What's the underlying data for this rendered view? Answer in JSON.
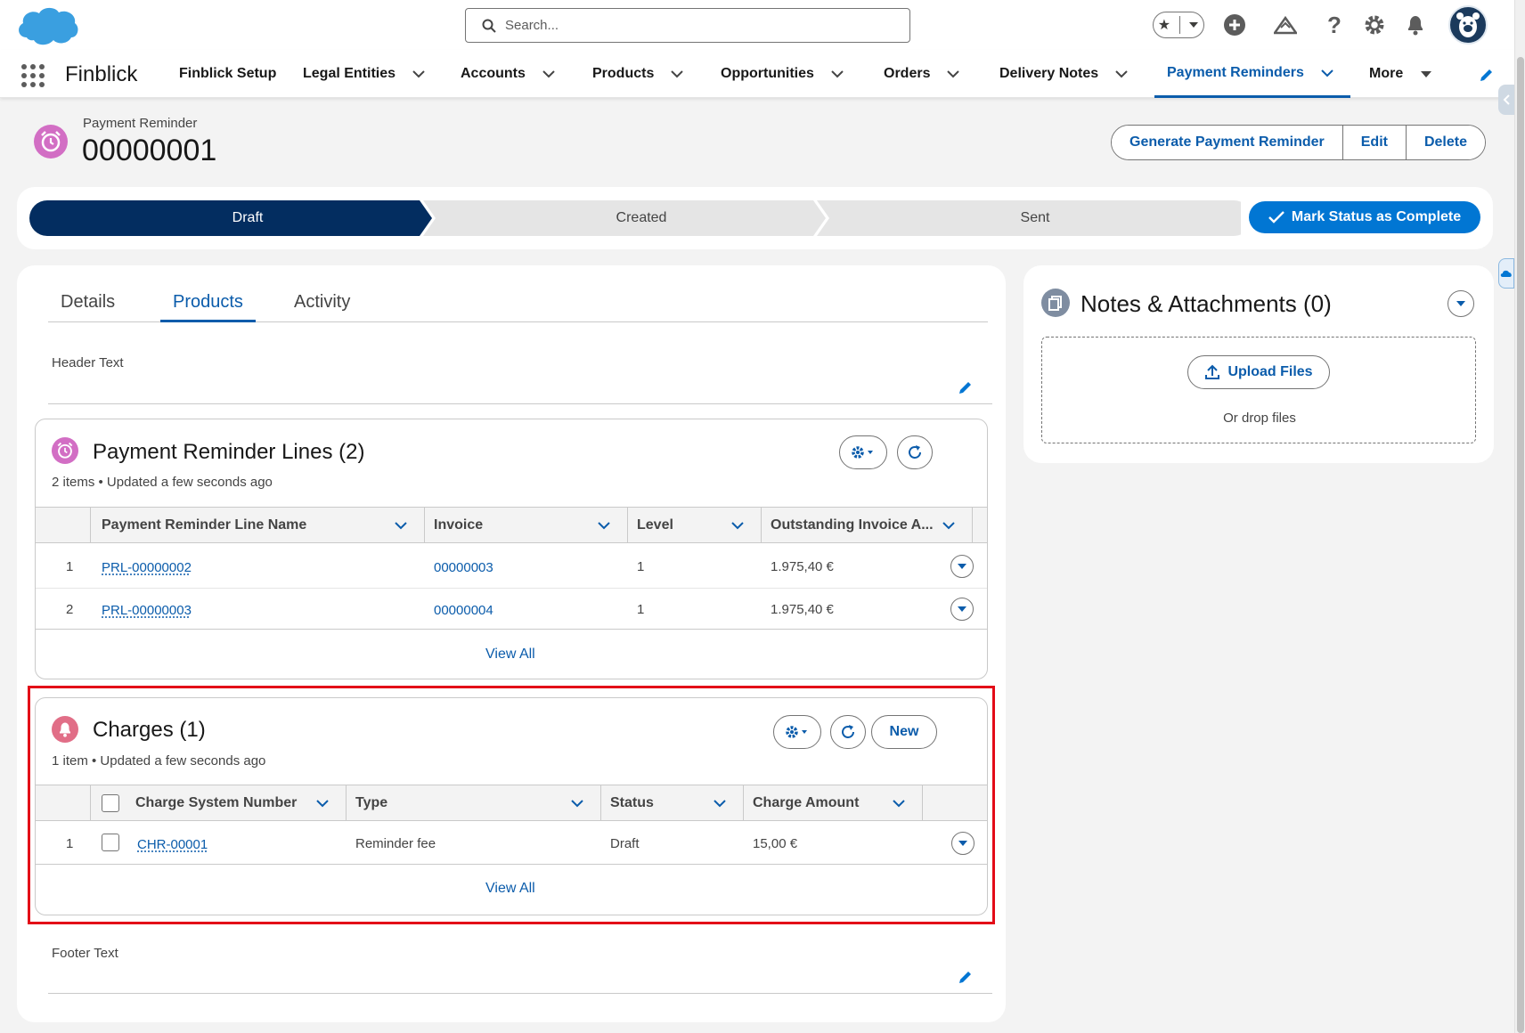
{
  "header": {
    "search_placeholder": "Search...",
    "icons": [
      "salesforce-cloud-logo",
      "star-icon",
      "chevron-down-icon",
      "add-icon",
      "trailhead-icon",
      "help-icon",
      "gear-icon",
      "bell-icon",
      "avatar"
    ]
  },
  "nav": {
    "app_name": "Finblick",
    "items": [
      {
        "label": "Finblick Setup",
        "has_chevron": false
      },
      {
        "label": "Legal Entities",
        "has_chevron": true
      },
      {
        "label": "Accounts",
        "has_chevron": true
      },
      {
        "label": "Products",
        "has_chevron": true
      },
      {
        "label": "Opportunities",
        "has_chevron": true
      },
      {
        "label": "Orders",
        "has_chevron": true
      },
      {
        "label": "Delivery Notes",
        "has_chevron": true
      },
      {
        "label": "Payment Reminders",
        "has_chevron": true,
        "active": true
      },
      {
        "label": "More",
        "has_chevron": true
      }
    ]
  },
  "record": {
    "type_label": "Payment Reminder",
    "name": "00000001",
    "actions": [
      "Generate Payment Reminder",
      "Edit",
      "Delete"
    ]
  },
  "path": {
    "stages": [
      "Draft",
      "Created",
      "Sent"
    ],
    "current_stage": "Draft",
    "complete_button": "Mark Status as Complete"
  },
  "tabs": {
    "items": [
      "Details",
      "Products",
      "Activity"
    ],
    "active": "Products"
  },
  "fields": {
    "header_text_label": "Header Text",
    "footer_text_label": "Footer Text"
  },
  "lines_list": {
    "title": "Payment Reminder Lines (2)",
    "subtitle": "2 items • Updated a few seconds ago",
    "columns": [
      "Payment Reminder Line Name",
      "Invoice",
      "Level",
      "Outstanding Invoice A..."
    ],
    "rows": [
      {
        "num": "1",
        "name": "PRL-00000002",
        "invoice": "00000003",
        "level": "1",
        "amount": "1.975,40 €"
      },
      {
        "num": "2",
        "name": "PRL-00000003",
        "invoice": "00000004",
        "level": "1",
        "amount": "1.975,40 €"
      }
    ],
    "view_all": "View All"
  },
  "charges_list": {
    "title": "Charges (1)",
    "subtitle": "1 item • Updated a few seconds ago",
    "new_button": "New",
    "columns": [
      "Charge System Number",
      "Type",
      "Status",
      "Charge Amount"
    ],
    "rows": [
      {
        "num": "1",
        "number": "CHR-00001",
        "type": "Reminder fee",
        "status": "Draft",
        "amount": "15,00 €"
      }
    ],
    "view_all": "View All"
  },
  "notes": {
    "title": "Notes & Attachments (0)",
    "upload_button": "Upload Files",
    "drop_text": "Or drop files"
  },
  "colors": {
    "brand_blue": "#0176d3",
    "link_blue": "#0b5cab",
    "path_active": "#032d60",
    "highlight_red": "#e30b17",
    "reminder_icon": "#d26ec4",
    "charges_icon": "#e16e87"
  }
}
